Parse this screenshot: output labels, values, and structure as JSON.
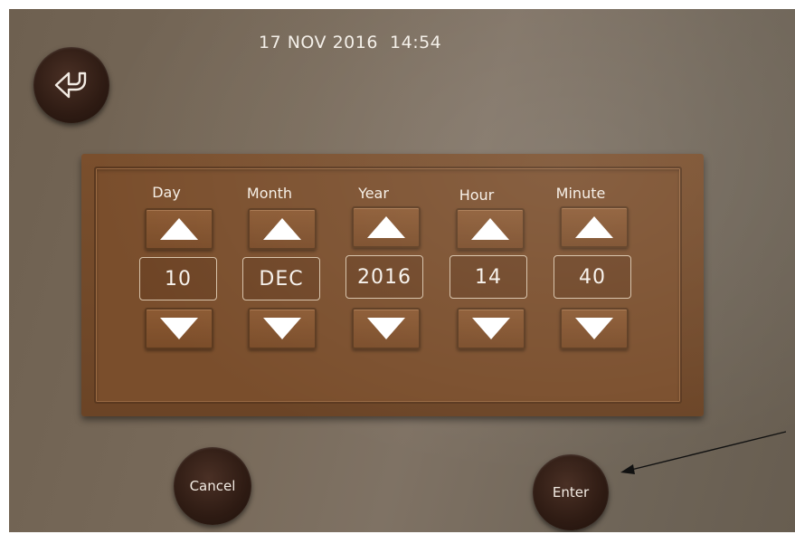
{
  "header": {
    "datetime": "17 NOV 2016  14:54"
  },
  "icons": {
    "back": "back-arrow-icon",
    "up": "triangle-up-icon",
    "down": "triangle-down-icon"
  },
  "colors": {
    "panel": "#7a4e2c",
    "round_button": "#2e1b13",
    "background": "#786a5a"
  },
  "fields": [
    {
      "label": "Day",
      "value": "10"
    },
    {
      "label": "Month",
      "value": "DEC"
    },
    {
      "label": "Year",
      "value": "2016"
    },
    {
      "label": "Hour",
      "value": "14"
    },
    {
      "label": "Minute",
      "value": "40"
    }
  ],
  "buttons": {
    "cancel": "Cancel",
    "enter": "Enter"
  }
}
